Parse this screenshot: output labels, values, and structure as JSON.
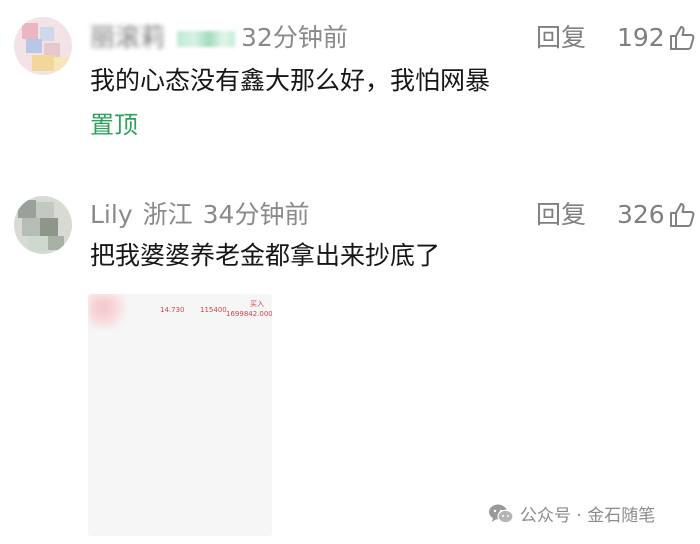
{
  "comments": [
    {
      "user_name": "丽滚莉",
      "time": "32分钟前",
      "reply_label": "回复",
      "likes": "192",
      "text": "我的心态没有鑫大那么好，我怕网暴",
      "pinned_label": "置顶"
    },
    {
      "user_name": "Lily",
      "location": "浙江",
      "time": "34分钟前",
      "reply_label": "回复",
      "likes": "326",
      "text": "把我婆婆养老金都拿出来抄底了",
      "image": {
        "price": "14.730",
        "shares": "115400",
        "action": "买入",
        "amount": "1699842.000"
      }
    }
  ],
  "watermark": {
    "account_type": "公众号",
    "separator": "·",
    "account_name": "金石随笔"
  },
  "colors": {
    "meta_gray": "#8a8a8a",
    "pinned_green": "#2aa35a",
    "trade_red": "#d0454d"
  },
  "icons": [
    "thumbs-up-icon",
    "wechat-icon"
  ]
}
